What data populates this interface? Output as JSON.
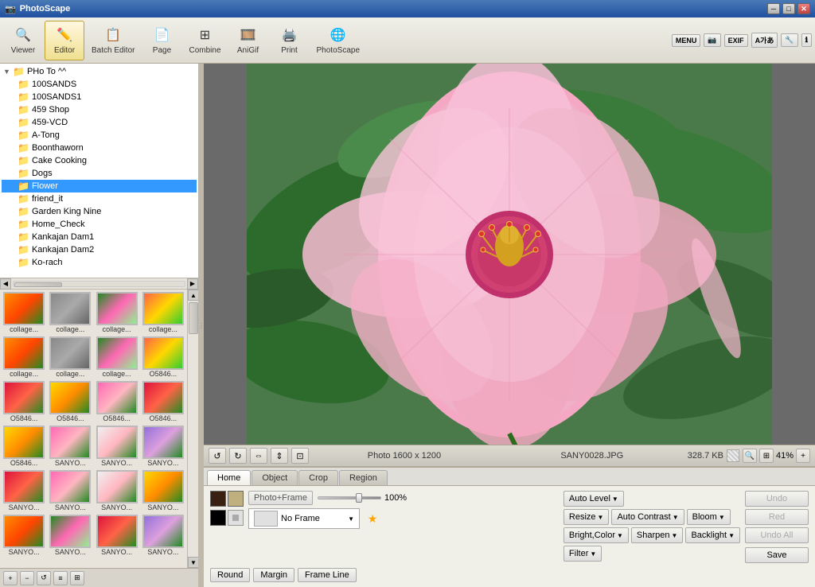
{
  "titlebar": {
    "title": "PhotoScape"
  },
  "toolbar": {
    "viewer_label": "Viewer",
    "editor_label": "Editor",
    "batch_label": "Batch Editor",
    "page_label": "Page",
    "combine_label": "Combine",
    "anigif_label": "AniGif",
    "print_label": "Print",
    "photoscape_label": "PhotoScape"
  },
  "file_tree": {
    "root": "PHo To ^^",
    "items": [
      {
        "label": "100SANDS",
        "indent": 2
      },
      {
        "label": "100SANDS1",
        "indent": 2
      },
      {
        "label": "459 Shop",
        "indent": 2
      },
      {
        "label": "459-VCD",
        "indent": 2
      },
      {
        "label": "A-Tong",
        "indent": 2
      },
      {
        "label": "Boonthaworn",
        "indent": 2
      },
      {
        "label": "Cake Cooking",
        "indent": 2
      },
      {
        "label": "Dogs",
        "indent": 2
      },
      {
        "label": "Flower",
        "indent": 2,
        "selected": true
      },
      {
        "label": "friend_it",
        "indent": 2
      },
      {
        "label": "Garden King Nine",
        "indent": 2
      },
      {
        "label": "Home_Check",
        "indent": 2
      },
      {
        "label": "Kankajan Dam1",
        "indent": 2
      },
      {
        "label": "Kankajan Dam2",
        "indent": 2
      },
      {
        "label": "Ko-rach",
        "indent": 2
      }
    ]
  },
  "thumbnails": [
    {
      "label": "collage...",
      "color": "orange"
    },
    {
      "label": "collage...",
      "color": "gray"
    },
    {
      "label": "collage...",
      "color": "green-pink"
    },
    {
      "label": "collage...",
      "color": "multi"
    },
    {
      "label": "collage...",
      "color": "orange"
    },
    {
      "label": "collage...",
      "color": "gray"
    },
    {
      "label": "collage...",
      "color": "green-pink"
    },
    {
      "label": "O5846...",
      "color": "multi"
    },
    {
      "label": "O5846...",
      "color": "red"
    },
    {
      "label": "O5846...",
      "color": "yellow"
    },
    {
      "label": "O5846...",
      "color": "pink"
    },
    {
      "label": "O5846...",
      "color": "red"
    },
    {
      "label": "O5846...",
      "color": "yellow"
    },
    {
      "label": "SANYO...",
      "color": "pink"
    },
    {
      "label": "SANYO...",
      "color": "white-flower"
    },
    {
      "label": "SANYO...",
      "color": "purple"
    },
    {
      "label": "SANYO...",
      "color": "red"
    },
    {
      "label": "SANYO...",
      "color": "pink"
    },
    {
      "label": "SANYO...",
      "color": "white-flower"
    },
    {
      "label": "SANYO...",
      "color": "yellow"
    },
    {
      "label": "SANYO...",
      "color": "orange"
    },
    {
      "label": "SANYO...",
      "color": "green-pink"
    },
    {
      "label": "SANYO...",
      "color": "red"
    },
    {
      "label": "SANYO...",
      "color": "purple"
    }
  ],
  "status_bar": {
    "photo_info": "Photo 1600 x 1200",
    "filename": "SANY0028.JPG",
    "filesize": "328.7 KB",
    "zoom": "41%"
  },
  "tabs": {
    "items": [
      "Home",
      "Object",
      "Crop",
      "Region"
    ],
    "active": "Home"
  },
  "editor": {
    "photo_frame_label": "Photo+Frame",
    "opacity_value": "100%",
    "no_frame_label": "No Frame",
    "auto_level_label": "Auto Level",
    "auto_contrast_label": "Auto Contrast",
    "bloom_label": "Bloom",
    "resize_label": "Resize",
    "sharpen_label": "Sharpen",
    "backlight_label": "Backlight",
    "bright_color_label": "Bright,Color",
    "filter_label": "Filter",
    "round_label": "Round",
    "margin_label": "Margin",
    "frame_line_label": "Frame Line",
    "undo_label": "Undo",
    "redo_label": "Red",
    "undo_all_label": "Undo All",
    "save_label": "Save"
  }
}
